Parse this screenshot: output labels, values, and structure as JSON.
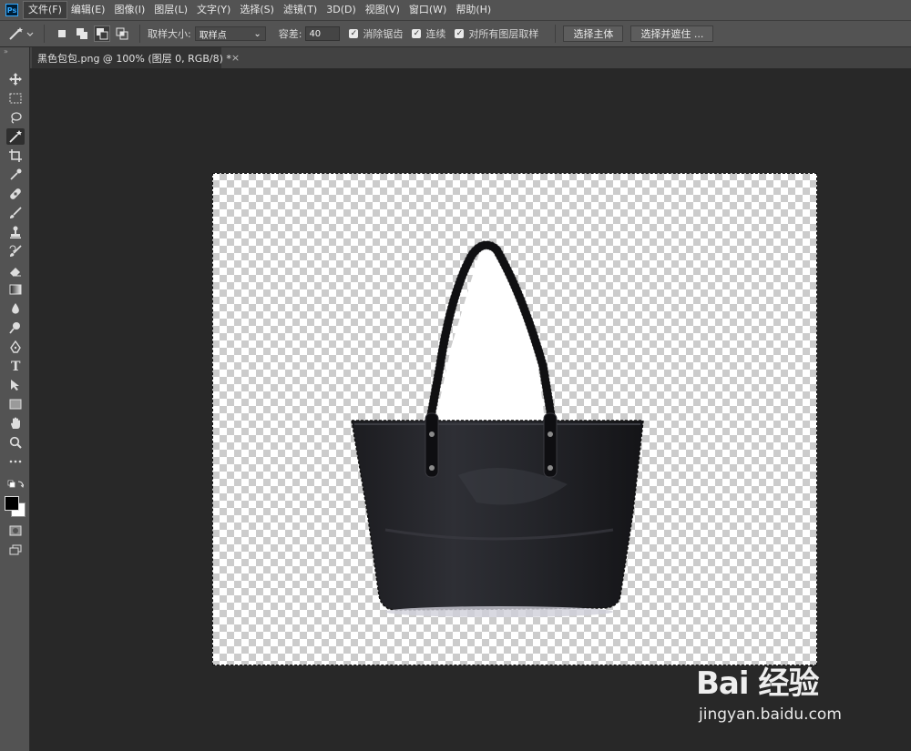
{
  "menubar": {
    "logo": "Ps",
    "items": [
      "文件(F)",
      "编辑(E)",
      "图像(I)",
      "图层(L)",
      "文字(Y)",
      "选择(S)",
      "滤镜(T)",
      "3D(D)",
      "视图(V)",
      "窗口(W)",
      "帮助(H)"
    ]
  },
  "options": {
    "sample_size_label": "取样大小:",
    "sample_size_value": "取样点",
    "tolerance_label": "容差:",
    "tolerance_value": "40",
    "antialias_label": "消除锯齿",
    "contiguous_label": "连续",
    "sample_all_label": "对所有图层取样",
    "select_subject_label": "选择主体",
    "select_mask_label": "选择并遮住 ..."
  },
  "document_tab": {
    "title": "黑色包包.png @ 100% (图层 0, RGB/8) *",
    "close": "×"
  },
  "watermark": {
    "logo_text": "Bai 经验",
    "url": "jingyan.baidu.com"
  },
  "colors": {
    "panel": "#535353",
    "workspace": "#282828",
    "accent": "#31a8ff"
  }
}
